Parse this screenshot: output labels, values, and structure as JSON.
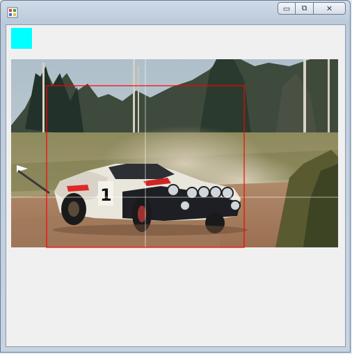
{
  "window": {
    "title": "",
    "controls": {
      "minimize": "▭",
      "maximize": "⧉",
      "close": "✕"
    }
  },
  "swatch": {
    "color": "#00ffff"
  },
  "overlay": {
    "rect_color": "#ff0000",
    "crosshair_color": "#ffffff"
  }
}
